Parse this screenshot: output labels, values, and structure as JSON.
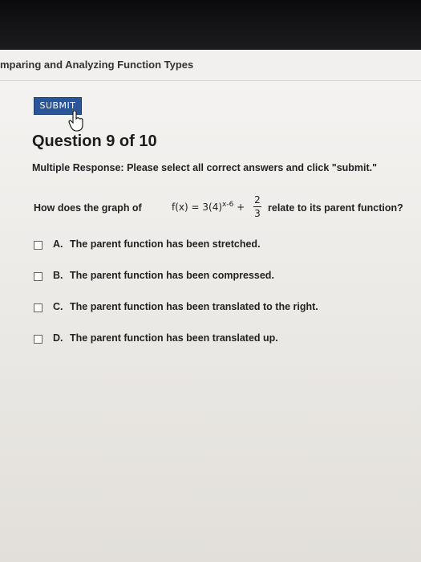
{
  "header": {
    "title": "mparing and Analyzing Function Types"
  },
  "toolbar": {
    "submit_label": "SUBMIT"
  },
  "question": {
    "title": "Question 9 of 10",
    "instructions": "Multiple Response: Please select all correct answers and click \"submit.\"",
    "prompt_before": "How does the graph of",
    "function_lhs": "f(x) = 3(4)",
    "function_exponent": "x-6",
    "function_plus": "+",
    "fraction_numerator": "2",
    "fraction_denominator": "3",
    "prompt_after": "relate to its parent function?"
  },
  "options": [
    {
      "letter": "A.",
      "text": "The parent function has been stretched.",
      "checked": false
    },
    {
      "letter": "B.",
      "text": "The parent function has been compressed.",
      "checked": false
    },
    {
      "letter": "C.",
      "text": "The parent function has been translated to the right.",
      "checked": false
    },
    {
      "letter": "D.",
      "text": "The parent function has been translated up.",
      "checked": false
    }
  ],
  "colors": {
    "submit_button": "#2a5598",
    "background": "#f4f3f1"
  }
}
